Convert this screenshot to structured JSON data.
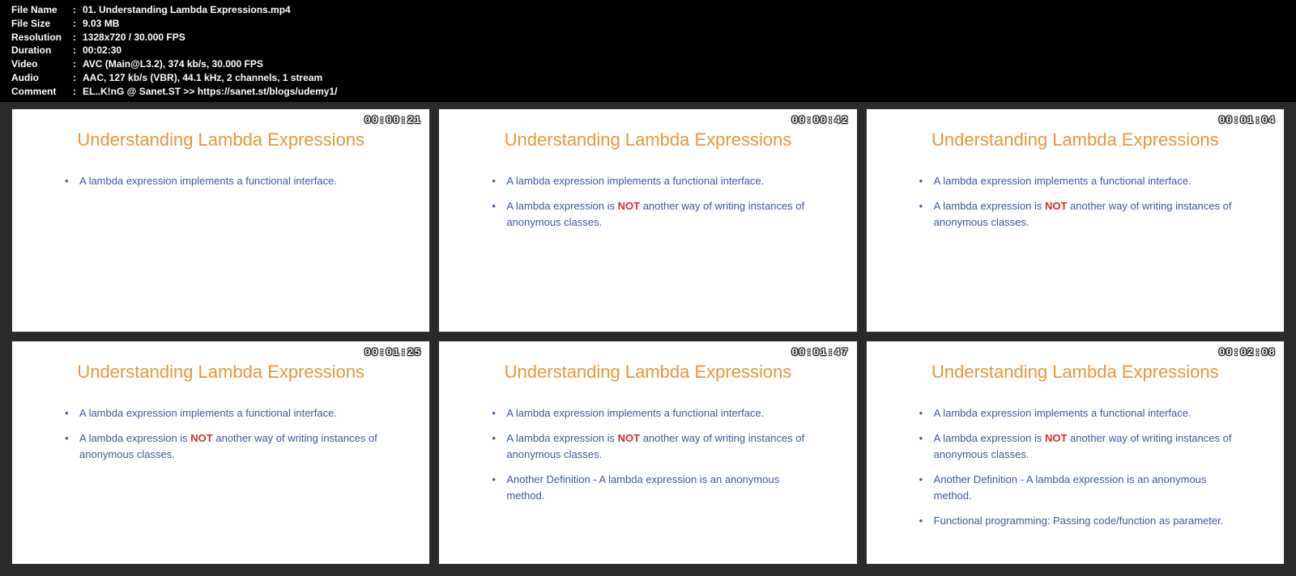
{
  "metadata": {
    "filename_label": "File Name",
    "filename_value": "01. Understanding Lambda Expressions.mp4",
    "filesize_label": "File Size",
    "filesize_value": "9.03 MB",
    "resolution_label": "Resolution",
    "resolution_value": "1328x720 / 30.000 FPS",
    "duration_label": "Duration",
    "duration_value": "00:02:30",
    "video_label": "Video",
    "video_value": "AVC (Main@L3.2), 374 kb/s, 30.000 FPS",
    "audio_label": "Audio",
    "audio_value": "AAC, 127 kb/s (VBR), 44.1 kHz, 2 channels, 1 stream",
    "comment_label": "Comment",
    "comment_value": "EL..K!nG @ Sanet.ST  >> https://sanet.st/blogs/udemy1/"
  },
  "slide_title": "Understanding Lambda Expressions",
  "bullets": {
    "b1": "A lambda expression implements a functional interface.",
    "b2_pre": "A lambda expression is ",
    "b2_not": "NOT",
    "b2_post": " another way of writing instances of anonymous classes.",
    "b3": "Another Definition - A lambda expression is an anonymous method.",
    "b4": "Functional programming: Passing code/function as parameter."
  },
  "timestamps": {
    "t1": "00:00:21",
    "t2": "00:00:42",
    "t3": "00:01:04",
    "t4": "00:01:25",
    "t5": "00:01:47",
    "t6": "00:02:08"
  },
  "sep": ":"
}
